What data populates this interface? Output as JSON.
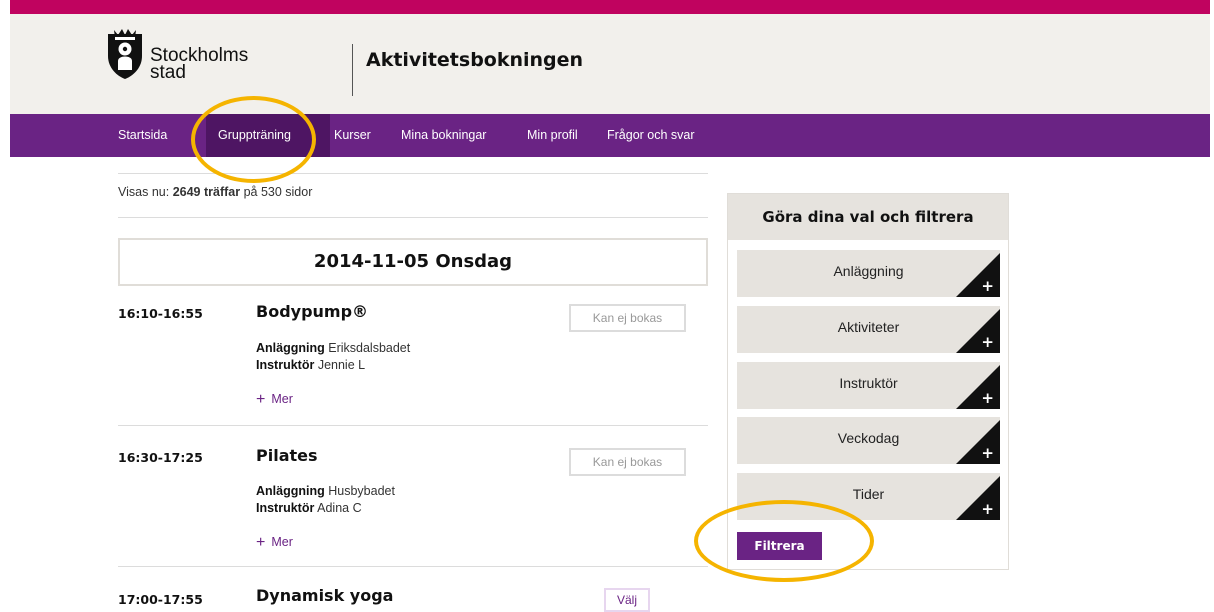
{
  "brand": {
    "logo_line1": "Stockholms",
    "logo_line2": "stad",
    "app_title": "Aktivitetsbokningen",
    "accent_color": "#c0035f",
    "nav_color": "#6a2384"
  },
  "nav": {
    "items": [
      {
        "label": "Startsida"
      },
      {
        "label": "Gruppträning",
        "active": true
      },
      {
        "label": "Kurser"
      },
      {
        "label": "Mina bokningar"
      },
      {
        "label": "Min profil"
      },
      {
        "label": "Frågor och svar"
      }
    ]
  },
  "results": {
    "prefix": "Visas nu:",
    "count": "2649 träffar",
    "suffix": "på 530 sidor"
  },
  "schedule": {
    "date_heading": "2014-11-05 Onsdag",
    "location_label": "Anläggning",
    "instructor_label": "Instruktör",
    "more_label": "Mer",
    "activities": [
      {
        "time": "16:10-16:55",
        "name": "Bodypump®",
        "location": "Eriksdalsbadet",
        "instructor": "Jennie L",
        "button": "Kan ej bokas"
      },
      {
        "time": "16:30-17:25",
        "name": "Pilates",
        "location": "Husbybadet",
        "instructor": "Adina C",
        "button": "Kan ej bokas"
      },
      {
        "time": "17:00-17:55",
        "name": "Dynamisk yoga",
        "button": "Välj"
      }
    ]
  },
  "filter": {
    "heading": "Göra dina val och filtrera",
    "options": [
      {
        "label": "Anläggning"
      },
      {
        "label": "Aktiviteter"
      },
      {
        "label": "Instruktör"
      },
      {
        "label": "Veckodag"
      },
      {
        "label": "Tider"
      }
    ],
    "submit_label": "Filtrera"
  },
  "annotations": {
    "highlight_color": "#f5b400"
  }
}
